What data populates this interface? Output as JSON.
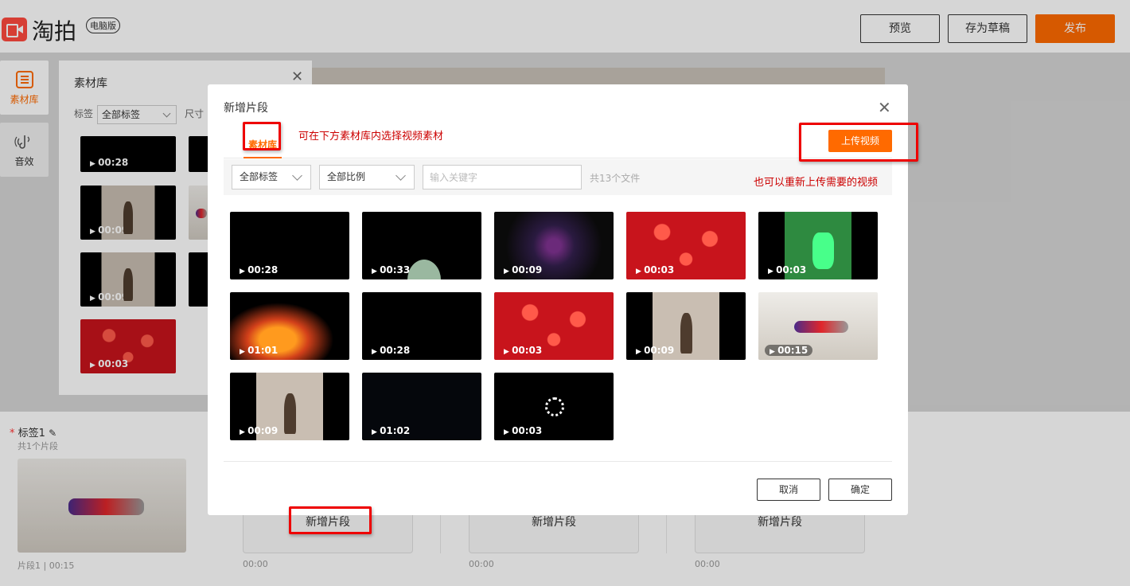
{
  "header": {
    "logo_text": "淘拍",
    "logo_badge": "电脑版",
    "buttons": {
      "preview": "预览",
      "save_draft": "存为草稿",
      "publish": "发布"
    }
  },
  "sidebar": {
    "items": [
      {
        "label": "素材库",
        "icon": "library-icon",
        "active": true
      },
      {
        "label": "音效",
        "icon": "audio-icon",
        "active": false
      }
    ]
  },
  "library_panel": {
    "title": "素材库",
    "filter_label": "标签",
    "filter_value": "全部标签",
    "size_label": "尺寸",
    "thumbs": [
      {
        "duration": "00:28"
      },
      {
        "duration": "00:09"
      },
      {
        "duration": "00:09"
      },
      {
        "duration": "00:03"
      }
    ]
  },
  "timeline": {
    "tag_label": "标签1",
    "tag_count": "共1个片段",
    "segment_info": "片段1 | 00:15",
    "slots": [
      {
        "label": "新增片段",
        "time": "00:00"
      },
      {
        "label": "新增片段",
        "time": "00:00"
      },
      {
        "label": "新增片段",
        "time": "00:00"
      }
    ]
  },
  "modal": {
    "title": "新增片段",
    "tab": "素材库",
    "hint_top": "可在下方素材库内选择视频素材",
    "upload_button": "上传视频",
    "filter_tag": "全部标签",
    "filter_ratio": "全部比例",
    "search_placeholder": "输入关键字",
    "file_count": "共13个文件",
    "hint_upload": "也可以重新上传需要的视频",
    "cancel": "取消",
    "confirm": "确定",
    "videos": [
      {
        "duration": "00:28",
        "theme": "black"
      },
      {
        "duration": "00:33",
        "theme": "cup"
      },
      {
        "duration": "00:09",
        "theme": "sparkle"
      },
      {
        "duration": "00:03",
        "theme": "strawberry"
      },
      {
        "duration": "00:03",
        "theme": "green-bottle"
      },
      {
        "duration": "01:01",
        "theme": "fire"
      },
      {
        "duration": "00:28",
        "theme": "black"
      },
      {
        "duration": "00:03",
        "theme": "strawberry"
      },
      {
        "duration": "00:09",
        "theme": "woman"
      },
      {
        "duration": "00:15",
        "theme": "vacuum"
      },
      {
        "duration": "00:09",
        "theme": "woman"
      },
      {
        "duration": "01:02",
        "theme": "dark-room"
      },
      {
        "duration": "00:03",
        "theme": "loading"
      }
    ]
  },
  "colors": {
    "accent": "#ff6a00",
    "annotation_red": "#e00000",
    "logo_red": "#ff4b3e"
  }
}
